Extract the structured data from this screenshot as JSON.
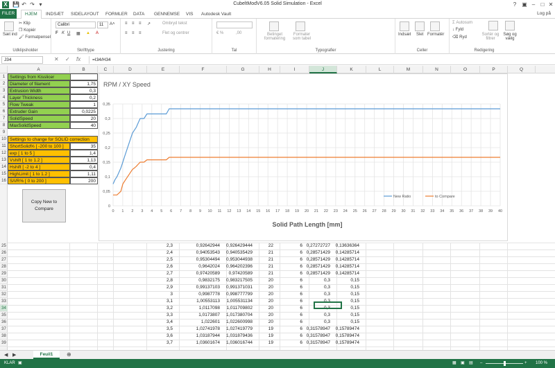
{
  "window": {
    "title": "CubeltModV6.05 Solid Simulation - Excel",
    "login": "Log på"
  },
  "tabs": [
    "FILER",
    "HJEM",
    "INDSÆT",
    "SIDELAYOUT",
    "FORMLER",
    "DATA",
    "GENNEMSE",
    "VIS",
    "Autodesk Vault"
  ],
  "ribbon": {
    "paste": "Sæt ind",
    "cut": "Klip",
    "copy": "Kopiér",
    "format_painter": "Formatpensel",
    "clipboard": "Udklipsholder",
    "font_name": "Calibri",
    "font_size": "11",
    "font_group": "Skrifttype",
    "wrap": "Ombryd tekst",
    "merge": "Flet og centrer",
    "align_group": "Justering",
    "number_group": "Tal",
    "cond_format": "Betinget formatering",
    "format_table": "Formater som tabel",
    "styles_group": "Typografier",
    "insert": "Indsæt",
    "delete": "Slet",
    "format": "Formatér",
    "cells_group": "Celler",
    "autosum": "Autosum",
    "fill": "Fyld",
    "clear": "Ryd",
    "sort": "Sortér og filtrer",
    "find": "Søg og vælg",
    "editing_group": "Redigering"
  },
  "formula_bar": {
    "name_box": "J34",
    "formula": "=I34/H34"
  },
  "columns": [
    "A",
    "B",
    "C",
    "D",
    "E",
    "F",
    "G",
    "H",
    "I",
    "J",
    "K",
    "L",
    "M",
    "N",
    "O",
    "P",
    "Q"
  ],
  "settings": {
    "header1": "Settings from Kisslicer",
    "rows1": [
      {
        "label": "Diameter of filament",
        "value": "1,75"
      },
      {
        "label": "Extrusion Width",
        "value": "0,3"
      },
      {
        "label": "Layer Thickness",
        "value": "0,2"
      },
      {
        "label": "Flow Tweak",
        "value": "1"
      },
      {
        "label": "Extruder Gain",
        "value": "0,0225"
      },
      {
        "label": "SolidSpeed",
        "value": "20"
      },
      {
        "label": "MaxSolidSpeed",
        "value": "40"
      }
    ],
    "header2": "Settings to change for SOLID correction",
    "rows2": [
      {
        "label": "ShortSolid% [ -200 to 100 ]",
        "value": "35"
      },
      {
        "label": "exp [ 1 to 5 ]",
        "value": "1,4"
      },
      {
        "label": "Vshift [ 1 to 1.2 ]",
        "value": "1,13"
      },
      {
        "label": "Hshift [ -2 to 4 ]",
        "value": "0,4"
      },
      {
        "label": "HighLimit [ 1 to 1.2 ]",
        "value": "1,11"
      },
      {
        "label": "S/I/R% [ 0 to 200 ]",
        "value": "200"
      }
    ]
  },
  "copy_button": "Copy New to Compare",
  "data_rows": [
    {
      "r": "25",
      "e": "2,3",
      "f": "0,92642944",
      "g": "0,926429444",
      "h": "22",
      "i": "6",
      "j": "0,27272727",
      "k": "0,13636364"
    },
    {
      "r": "26",
      "e": "2,4",
      "f": "0,94053543",
      "g": "0,940535429",
      "h": "21",
      "i": "6",
      "j": "0,28571429",
      "k": "0,14285714"
    },
    {
      "r": "27",
      "e": "2,5",
      "f": "0,95304494",
      "g": "0,953044938",
      "h": "21",
      "i": "6",
      "j": "0,28571429",
      "k": "0,14285714"
    },
    {
      "r": "28",
      "e": "2,6",
      "f": "0,9642024",
      "g": "0,964202396",
      "h": "21",
      "i": "6",
      "j": "0,28571429",
      "k": "0,14285714"
    },
    {
      "r": "29",
      "e": "2,7",
      "f": "0,97420589",
      "g": "0,97420589",
      "h": "21",
      "i": "6",
      "j": "0,28571429",
      "k": "0,14285714"
    },
    {
      "r": "30",
      "e": "2,8",
      "f": "0,9832175",
      "g": "0,983217505",
      "h": "20",
      "i": "6",
      "j": "0,3",
      "k": "0,15"
    },
    {
      "r": "31",
      "e": "2,9",
      "f": "0,99137103",
      "g": "0,991371031",
      "h": "20",
      "i": "6",
      "j": "0,3",
      "k": "0,15"
    },
    {
      "r": "32",
      "e": "3",
      "f": "0,9987778",
      "g": "0,998777799",
      "h": "20",
      "i": "6",
      "j": "0,3",
      "k": "0,15"
    },
    {
      "r": "33",
      "e": "3,1",
      "f": "1,00553113",
      "g": "1,005531134",
      "h": "20",
      "i": "6",
      "j": "0,3",
      "k": "0,15"
    },
    {
      "r": "34",
      "e": "3,2",
      "f": "1,0117098",
      "g": "1,011709802",
      "h": "20",
      "i": "6",
      "j": "0,3",
      "k": "0,15"
    },
    {
      "r": "35",
      "e": "3,3",
      "f": "1,0173807",
      "g": "1,017380704",
      "h": "20",
      "i": "6",
      "j": "0,3",
      "k": "0,15"
    },
    {
      "r": "36",
      "e": "3,4",
      "f": "1,022601",
      "g": "1,022600998",
      "h": "20",
      "i": "6",
      "j": "0,3",
      "k": "0,15"
    },
    {
      "r": "37",
      "e": "3,5",
      "f": "1,02741978",
      "g": "1,027419779",
      "h": "19",
      "i": "6",
      "j": "0,31578947",
      "k": "0,15789474"
    },
    {
      "r": "38",
      "e": "3,6",
      "f": "1,03187944",
      "g": "1,031879436",
      "h": "19",
      "i": "6",
      "j": "0,31578947",
      "k": "0,15789474"
    },
    {
      "r": "39",
      "e": "3,7",
      "f": "1,03601674",
      "g": "1,036016744",
      "h": "19",
      "i": "6",
      "j": "0,31578947",
      "k": "0,15789474"
    }
  ],
  "chart_data": {
    "type": "line",
    "title": "RPM / XY Speed",
    "xlabel": "Solid Path Length [mm]",
    "ylabel": "",
    "xlim": [
      0,
      40
    ],
    "ylim": [
      0,
      0.35
    ],
    "xticks": [
      "0",
      "1",
      "2",
      "3",
      "4",
      "5",
      "6",
      "7",
      "8",
      "9",
      "10",
      "11",
      "12",
      "13",
      "14",
      "15",
      "16",
      "17",
      "18",
      "19",
      "20",
      "21",
      "22",
      "23",
      "24",
      "25",
      "26",
      "27",
      "28",
      "29",
      "30",
      "31",
      "32",
      "33",
      "34",
      "35",
      "36",
      "37",
      "38",
      "39",
      "40"
    ],
    "yticks": [
      "0",
      "0,05",
      "0,1",
      "0,15",
      "0,2",
      "0,25",
      "0,3",
      "0,35"
    ],
    "grid": true,
    "legend_position": "bottom-right",
    "series": [
      {
        "name": "New Ratio",
        "color": "#5b9bd5",
        "x": [
          0,
          0.2,
          0.4,
          0.6,
          0.8,
          1,
          1.2,
          1.4,
          1.6,
          1.8,
          2,
          2.2,
          2.4,
          2.6,
          2.8,
          3.2,
          3.5,
          4,
          4.5,
          5,
          5.5,
          5.8,
          40
        ],
        "y": [
          0.075,
          0.09,
          0.1,
          0.115,
          0.13,
          0.15,
          0.17,
          0.19,
          0.21,
          0.23,
          0.25,
          0.26,
          0.27,
          0.2857,
          0.3,
          0.3,
          0.3158,
          0.3158,
          0.3158,
          0.3158,
          0.3158,
          0.3333,
          0.3333
        ]
      },
      {
        "name": "to Compare",
        "color": "#ed7d31",
        "x": [
          0,
          0.4,
          0.8,
          1,
          1.2,
          1.4,
          1.6,
          1.8,
          2,
          2.2,
          2.4,
          2.6,
          2.8,
          3.2,
          3.5,
          4,
          4.5,
          5,
          5.5,
          5.8,
          40
        ],
        "y": [
          0.0375,
          0.0375,
          0.05,
          0.075,
          0.085,
          0.095,
          0.105,
          0.115,
          0.125,
          0.13,
          0.136,
          0.143,
          0.15,
          0.15,
          0.158,
          0.158,
          0.158,
          0.158,
          0.158,
          0.1667,
          0.1667
        ]
      }
    ]
  },
  "sheet_tab": "Feuil1",
  "status": {
    "ready": "KLAR",
    "zoom": "100 %"
  }
}
